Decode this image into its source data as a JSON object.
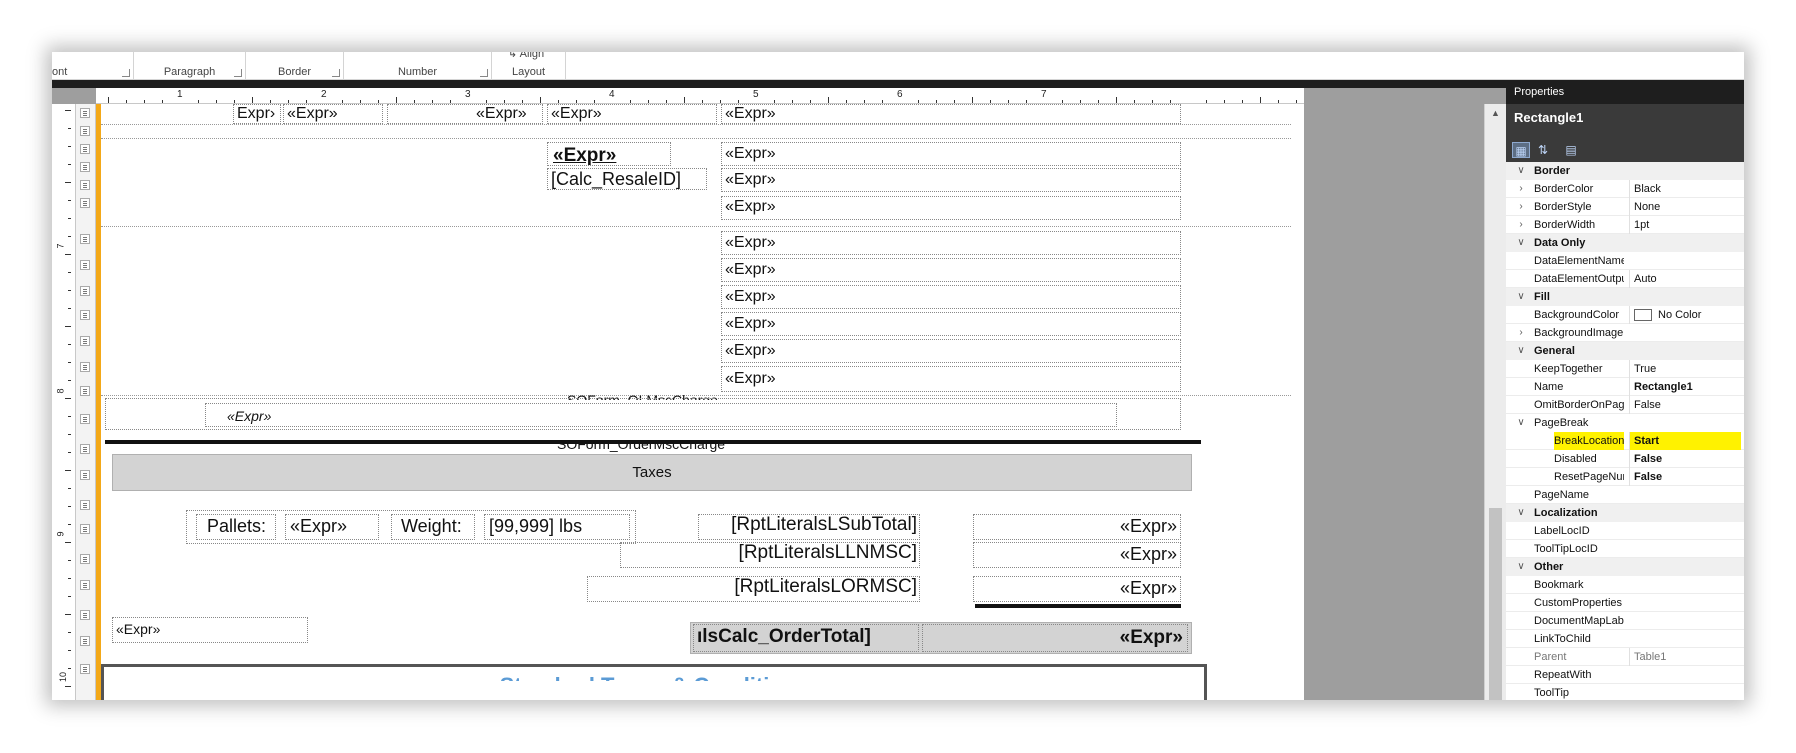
{
  "ribbon": {
    "groups": [
      "ont",
      "Paragraph",
      "Border",
      "Number",
      "Layout"
    ],
    "align_label": "Align"
  },
  "ruler": {
    "numbers": [
      "1",
      "2",
      "3",
      "4",
      "5",
      "6",
      "7"
    ],
    "left_numbers": [
      "7",
      "8",
      "9",
      "10"
    ]
  },
  "report": {
    "row1": [
      "Expr›",
      "«Expr»",
      "«Expr»",
      "«Expr»",
      "«Expr»"
    ],
    "expr_bold": "«Expr»",
    "calc_resale": "[Calc_ResaleID]",
    "right_exprs": [
      "«Expr»",
      "«Expr»",
      "«Expr»",
      "«Expr»",
      "«Expr»",
      "«Expr»",
      "«Expr»",
      "«Expr»",
      "«Expr»"
    ],
    "misc_charge_cut": "SOForm_OLMscCharge",
    "italic_expr": "«Expr»",
    "order_misc_cut": "SOForm_OrderMscCharge",
    "taxes": "Taxes",
    "pallets_label": "Pallets:",
    "pallets_value": "«Expr»",
    "weight_label": "Weight:",
    "weight_value": "[99,999] lbs",
    "subtotal_label": "[RptLiteralsLSubTotal]",
    "lnmsc_label": "[RptLiteralsLLNMSC]",
    "ormsc_label": "[RptLiteralsLORMSC]",
    "total_exprs": [
      "«Expr»",
      "«Expr»",
      "«Expr»"
    ],
    "footer_expr": "«Expr»",
    "order_total_label": "ılsCalc_OrderTotal]",
    "order_total_value": "«Expr»",
    "terms_cut": "Standard Terms & Conditions"
  },
  "properties": {
    "panel_title": "Properties",
    "object_name": "Rectangle1",
    "rows": [
      {
        "type": "cat",
        "name": "Border"
      },
      {
        "type": "prop",
        "name": "BorderColor",
        "value": "Black",
        "expandable": true
      },
      {
        "type": "prop",
        "name": "BorderStyle",
        "value": "None",
        "expandable": true
      },
      {
        "type": "prop",
        "name": "BorderWidth",
        "value": "1pt",
        "expandable": true
      },
      {
        "type": "cat",
        "name": "Data Only"
      },
      {
        "type": "prop",
        "name": "DataElementName",
        "value": ""
      },
      {
        "type": "prop",
        "name": "DataElementOutput",
        "value": "Auto"
      },
      {
        "type": "cat",
        "name": "Fill"
      },
      {
        "type": "prop",
        "name": "BackgroundColor",
        "value": "No Color",
        "swatch": true
      },
      {
        "type": "prop",
        "name": "BackgroundImage",
        "value": "",
        "expandable": true
      },
      {
        "type": "cat",
        "name": "General"
      },
      {
        "type": "prop",
        "name": "KeepTogether",
        "value": "True"
      },
      {
        "type": "prop",
        "name": "Name",
        "value": "Rectangle1",
        "bold": true
      },
      {
        "type": "prop",
        "name": "OmitBorderOnPageBreak",
        "value": "False"
      },
      {
        "type": "cat",
        "name": "PageBreak",
        "plain": true
      },
      {
        "type": "prop",
        "name": "BreakLocation",
        "value": "Start",
        "bold": true,
        "sub": true,
        "highlight": true
      },
      {
        "type": "prop",
        "name": "Disabled",
        "value": "False",
        "bold": true,
        "sub": true
      },
      {
        "type": "prop",
        "name": "ResetPageNumber",
        "value": "False",
        "bold": true,
        "sub": true
      },
      {
        "type": "prop",
        "name": "PageName",
        "value": ""
      },
      {
        "type": "cat",
        "name": "Localization"
      },
      {
        "type": "prop",
        "name": "LabelLocID",
        "value": ""
      },
      {
        "type": "prop",
        "name": "ToolTipLocID",
        "value": ""
      },
      {
        "type": "cat",
        "name": "Other"
      },
      {
        "type": "prop",
        "name": "Bookmark",
        "value": ""
      },
      {
        "type": "prop",
        "name": "CustomProperties",
        "value": ""
      },
      {
        "type": "prop",
        "name": "DocumentMapLabel",
        "value": ""
      },
      {
        "type": "prop",
        "name": "LinkToChild",
        "value": ""
      },
      {
        "type": "prop",
        "name": "Parent",
        "value": "Table1",
        "grey": true
      },
      {
        "type": "prop",
        "name": "RepeatWith",
        "value": ""
      },
      {
        "type": "prop",
        "name": "ToolTip",
        "value": ""
      }
    ]
  }
}
